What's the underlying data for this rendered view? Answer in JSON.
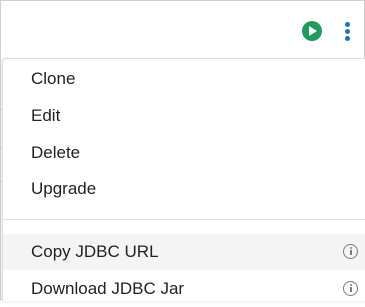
{
  "toolbar": {
    "run_icon": "play-circle-icon",
    "more_icon": "more-vertical-icon",
    "run_color": "#1f9b5e",
    "more_color": "#1d74b8"
  },
  "menu": {
    "items": [
      {
        "label": "Clone"
      },
      {
        "label": "Edit"
      },
      {
        "label": "Delete"
      },
      {
        "label": "Upgrade"
      }
    ],
    "secondary_items": [
      {
        "label": "Copy JDBC URL",
        "icon": "info-icon",
        "highlighted": true
      },
      {
        "label": "Download JDBC Jar",
        "icon": "info-icon"
      }
    ]
  }
}
